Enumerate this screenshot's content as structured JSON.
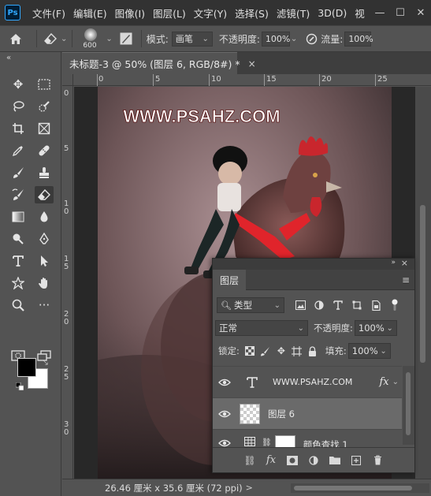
{
  "app": {
    "logo": "Ps"
  },
  "menu": [
    "文件(F)",
    "编辑(E)",
    "图像(I)",
    "图层(L)",
    "文字(Y)",
    "选择(S)",
    "滤镜(T)",
    "3D(D)",
    "视"
  ],
  "window_controls": [
    "—",
    "☐",
    "✕"
  ],
  "options_bar": {
    "brush_size": "600",
    "mode_label": "模式:",
    "mode_value": "画笔",
    "opacity_label": "不透明度:",
    "opacity_value": "100%",
    "flow_label": "流量:",
    "flow_value": "100%"
  },
  "document_tab": {
    "title": "未标题-3 @ 50% (图层 6, RGB/8#) *",
    "close": "×"
  },
  "ruler": {
    "top_labels": [
      "0",
      "5",
      "10",
      "15",
      "20",
      "25"
    ],
    "left_labels": [
      "0",
      "5",
      "1",
      "0",
      "1",
      "5",
      "2",
      "0",
      "2",
      "5",
      "3",
      "0"
    ]
  },
  "artwork": {
    "watermark": "WWW.PSAHZ.COM"
  },
  "status_bar": {
    "text": "26.46 厘米 x 35.6 厘米 (72 ppi)",
    "arrow": ">"
  },
  "layers_panel": {
    "tab": "图层",
    "filter_kind": "类型",
    "blend_mode": "正常",
    "opacity_label": "不透明度:",
    "opacity_value": "100%",
    "lock_label": "锁定:",
    "fill_label": "填充:",
    "fill_value": "100%",
    "layers": [
      {
        "name": "WWW.PSAHZ.COM",
        "type": "text",
        "fx": "fx"
      },
      {
        "name": "图层 6",
        "type": "pixel",
        "selected": true
      },
      {
        "name": "颜色查找 1",
        "type": "adjustment"
      }
    ]
  },
  "colors": {
    "foreground": "#000000",
    "background": "#ffffff"
  }
}
